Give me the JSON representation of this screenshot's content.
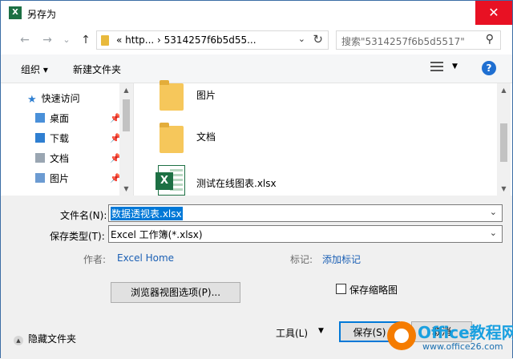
{
  "window": {
    "title": "另存为",
    "app_icon_text": "X",
    "close_glyph": "✕"
  },
  "nav": {
    "back_glyph": "←",
    "forward_glyph": "→",
    "recent_glyph": "⌄",
    "up_glyph": "↑",
    "breadcrumb": "«  http...  ›  5314257f6b5d55...",
    "chevron_glyph": "⌄",
    "refresh_glyph": "↻"
  },
  "search": {
    "placeholder": "搜索\"5314257f6b5d5517\"",
    "icon_glyph": "⚲"
  },
  "toolbar": {
    "organize": "组织 ▾",
    "new_folder": "新建文件夹",
    "view_dropdown": "▼",
    "help": "?"
  },
  "sidebar": {
    "quick_access": "快速访问",
    "items": [
      {
        "label": "桌面",
        "color": "#4a90d9"
      },
      {
        "label": "下载",
        "color": "#2f7fd1"
      },
      {
        "label": "文档",
        "color": "#9aa6b2"
      },
      {
        "label": "图片",
        "color": "#6c9bd2"
      }
    ],
    "pin_glyph": "📌"
  },
  "files": [
    {
      "name": "图片",
      "type": "folder"
    },
    {
      "name": "文档",
      "type": "folder"
    },
    {
      "name": "测试在线图表.xlsx",
      "type": "excel"
    }
  ],
  "form": {
    "filename_label": "文件名(N):",
    "filename_value": "数据透视表.xlsx",
    "filetype_label": "保存类型(T):",
    "filetype_value": "Excel 工作簿(*.xlsx)",
    "author_label": "作者:",
    "author_value": "Excel Home",
    "tags_label": "标记:",
    "tags_value": "添加标记",
    "browser_options": "浏览器视图选项(P)...",
    "save_thumbnail": "保存缩略图",
    "hide_folders": "隐藏文件夹",
    "tools": "工具(L)",
    "tools_dropdown": "▼",
    "save": "保存(S)",
    "cancel": "取消"
  },
  "watermark": {
    "brand": "Office教程网",
    "url": "www.office26.com"
  },
  "colors": {
    "accent": "#0078d7",
    "close_red": "#e81123",
    "link": "#1a5fb4",
    "excel_green": "#1d7044"
  }
}
